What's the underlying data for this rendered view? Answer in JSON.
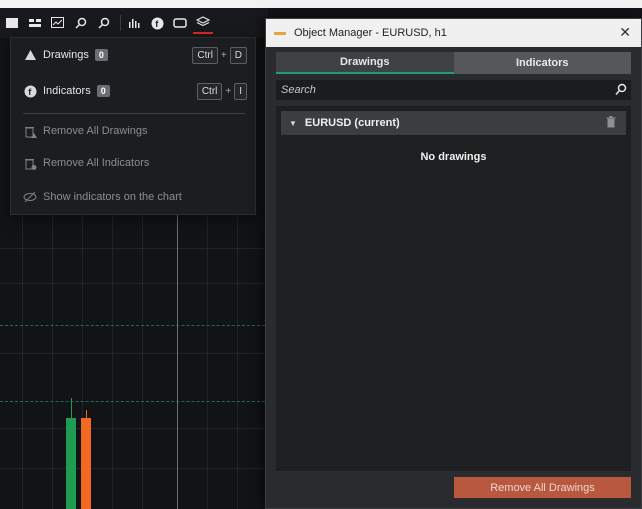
{
  "toolbar": {
    "buttons": [
      "layout-icon",
      "list-icon",
      "chart-box-icon",
      "zoom-in-icon",
      "zoom-out-icon",
      "volume-icon",
      "indicator-icon",
      "template-icon",
      "layers-icon"
    ]
  },
  "menu": {
    "drawings": {
      "label": "Drawings",
      "count": "0",
      "shortcut_mod": "Ctrl",
      "shortcut_plus": "+",
      "shortcut_key": "D"
    },
    "indicators": {
      "label": "Indicators",
      "count": "0",
      "shortcut_mod": "Ctrl",
      "shortcut_plus": "+",
      "shortcut_key": "I"
    },
    "remove_drawings": "Remove All Drawings",
    "remove_indicators": "Remove All Indicators",
    "show_indicators": "Show indicators on the chart"
  },
  "object_manager": {
    "title": "Object Manager - EURUSD, h1",
    "close": "✕",
    "tabs": [
      {
        "label": "Drawings",
        "active": true
      },
      {
        "label": "Indicators",
        "active": false
      }
    ],
    "search_placeholder": "Search",
    "group_label": "EURUSD (current)",
    "empty_text": "No drawings",
    "remove_button": "Remove All Drawings"
  },
  "colors": {
    "accent_green": "#1f9e6e",
    "bull_candle": "#1e9c52",
    "bear_candle": "#f26a22",
    "remove_button": "#b7583f",
    "active_underline": "#e02424"
  }
}
